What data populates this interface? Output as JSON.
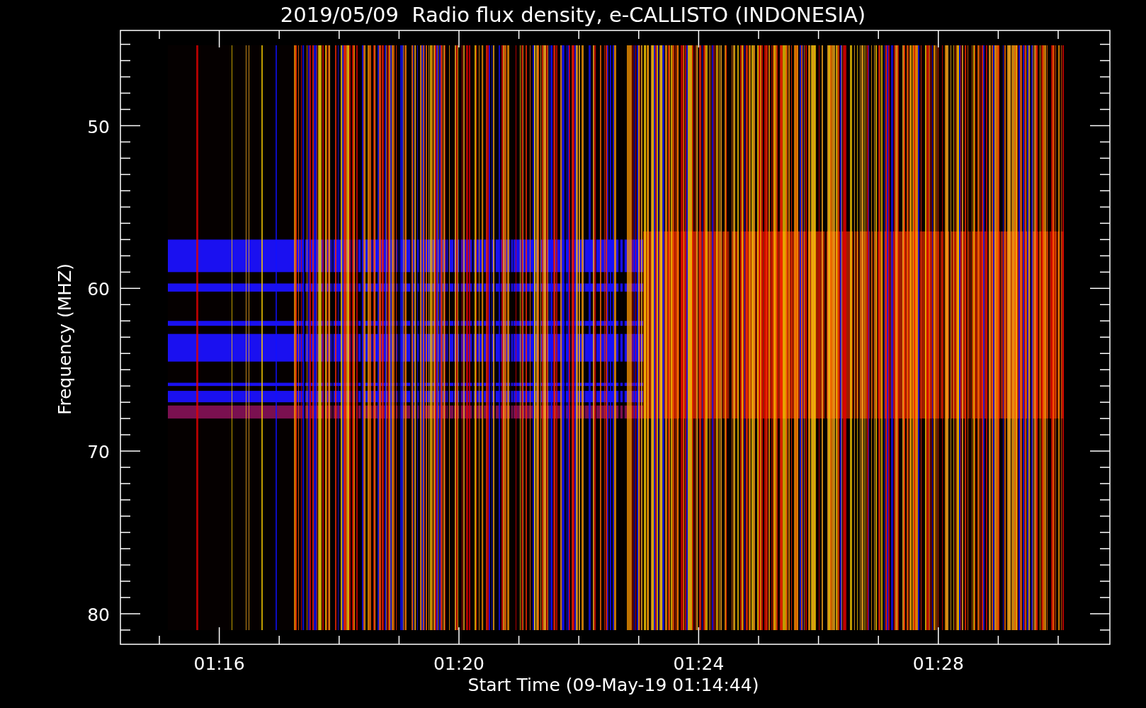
{
  "plot": {
    "title": "2019/05/09  Radio flux density, e-CALLISTO (INDONESIA)",
    "y_axis": {
      "label": "Frequency (MHZ)",
      "ticks": [
        "50",
        "60",
        "70",
        "80"
      ]
    },
    "x_axis": {
      "label": "Start Time (09-May-19 01:14:44)",
      "ticks": [
        "01:16",
        "01:20",
        "01:24",
        "01:28"
      ]
    }
  }
}
